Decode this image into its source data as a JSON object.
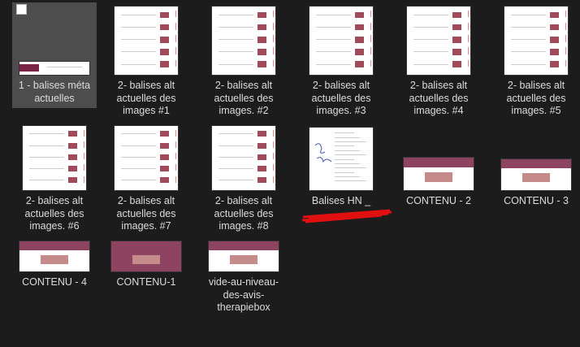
{
  "items": [
    {
      "label": "1 - balises méta actuelles",
      "kind": "meta",
      "selected": true
    },
    {
      "label": "2- balises alt actuelles des images #1",
      "kind": "list"
    },
    {
      "label": "2- balises alt actuelles des images. #2",
      "kind": "list"
    },
    {
      "label": "2- balises alt actuelles des images. #3",
      "kind": "list"
    },
    {
      "label": "2- balises alt actuelles des images. #4",
      "kind": "list"
    },
    {
      "label": "2- balises alt actuelles des images. #5",
      "kind": "list"
    },
    {
      "label": "2- balises alt actuelles des images. #6",
      "kind": "list"
    },
    {
      "label": "2- balises alt actuelles des images. #7",
      "kind": "list"
    },
    {
      "label": "2- balises alt actuelles des images. #8",
      "kind": "list"
    },
    {
      "label": "Balises HN _",
      "kind": "doc"
    },
    {
      "label": "CONTENU - 2",
      "kind": "wide"
    },
    {
      "label": "CONTENU - 3",
      "kind": "wide"
    },
    {
      "label": "CONTENU - 4",
      "kind": "wide"
    },
    {
      "label": "CONTENU-1",
      "kind": "wide"
    },
    {
      "label": "vide-au-niveau-des-avis-therapiebox",
      "kind": "wide"
    }
  ],
  "colors": {
    "background": "#1c1c1c",
    "selection": "#4d4d4d",
    "brand": "#7a2344",
    "redaction": "#e01010"
  }
}
